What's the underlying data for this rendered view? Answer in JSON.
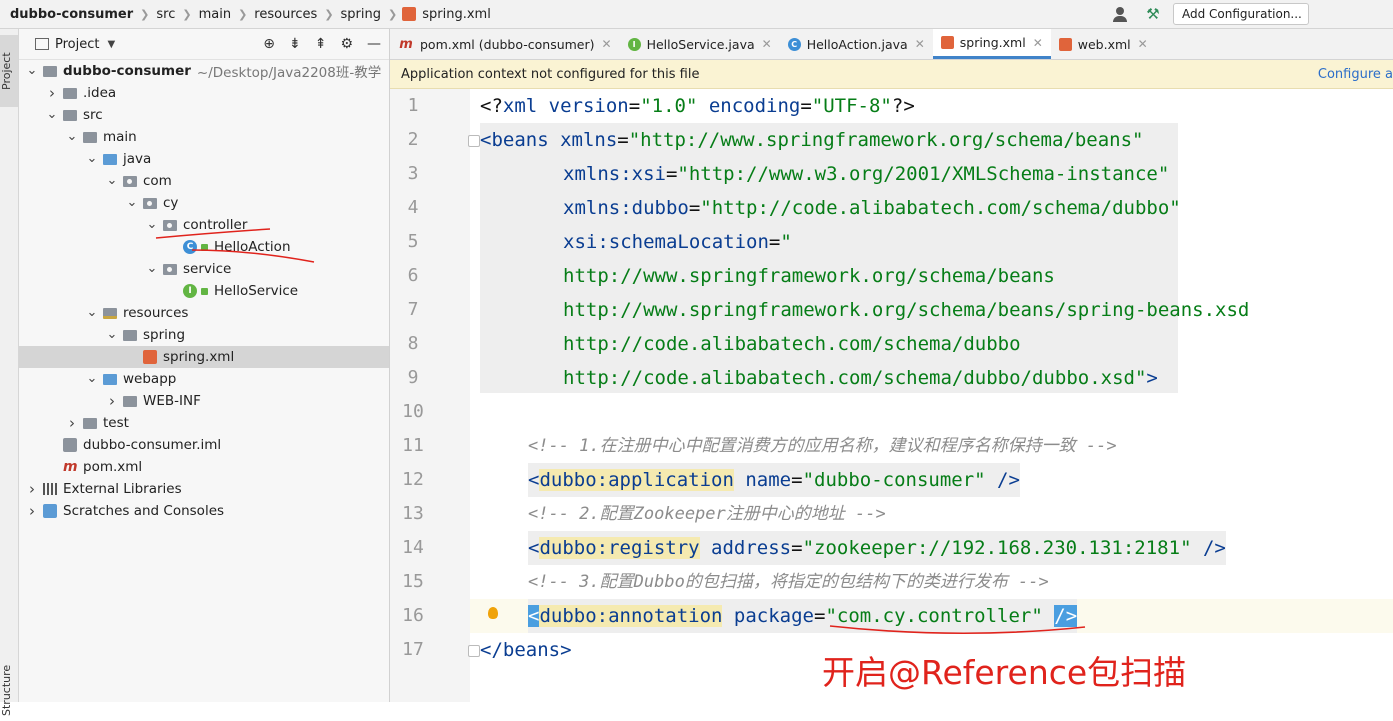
{
  "breadcrumb": {
    "segments": [
      "dubbo-consumer",
      "src",
      "main",
      "resources",
      "spring",
      "spring.xml"
    ]
  },
  "toolbar": {
    "add_configuration": "Add Configuration..."
  },
  "side_stripe": {
    "project": "Project",
    "structure": "Structure"
  },
  "project_panel": {
    "title": "Project",
    "tree": [
      {
        "label": "dubbo-consumer",
        "extra": "~/Desktop/Java2208班-教学",
        "depth": 0,
        "arrow": "down",
        "icon": "folder"
      },
      {
        "label": ".idea",
        "depth": 1,
        "arrow": "right",
        "icon": "folder"
      },
      {
        "label": "src",
        "depth": 1,
        "arrow": "down",
        "icon": "folder"
      },
      {
        "label": "main",
        "depth": 2,
        "arrow": "down",
        "icon": "folder"
      },
      {
        "label": "java",
        "depth": 3,
        "arrow": "down",
        "icon": "folder-blue"
      },
      {
        "label": "com",
        "depth": 4,
        "arrow": "down",
        "icon": "package"
      },
      {
        "label": "cy",
        "depth": 5,
        "arrow": "down",
        "icon": "package"
      },
      {
        "label": "controller",
        "depth": 6,
        "arrow": "down",
        "icon": "package"
      },
      {
        "label": "HelloAction",
        "depth": 7,
        "arrow": "",
        "icon": "class"
      },
      {
        "label": "service",
        "depth": 6,
        "arrow": "down",
        "icon": "package"
      },
      {
        "label": "HelloService",
        "depth": 7,
        "arrow": "",
        "icon": "interface"
      },
      {
        "label": "resources",
        "depth": 3,
        "arrow": "down",
        "icon": "folder-res"
      },
      {
        "label": "spring",
        "depth": 4,
        "arrow": "down",
        "icon": "folder"
      },
      {
        "label": "spring.xml",
        "depth": 5,
        "arrow": "",
        "icon": "xml",
        "selected": true
      },
      {
        "label": "webapp",
        "depth": 3,
        "arrow": "down",
        "icon": "folder-blue"
      },
      {
        "label": "WEB-INF",
        "depth": 4,
        "arrow": "right",
        "icon": "folder"
      },
      {
        "label": "test",
        "depth": 2,
        "arrow": "right",
        "icon": "folder"
      },
      {
        "label": "dubbo-consumer.iml",
        "depth": 1,
        "arrow": "",
        "icon": "iml"
      },
      {
        "label": "pom.xml",
        "depth": 1,
        "arrow": "",
        "icon": "maven"
      },
      {
        "label": "External Libraries",
        "depth": 0,
        "arrow": "right",
        "icon": "lib"
      },
      {
        "label": "Scratches and Consoles",
        "depth": 0,
        "arrow": "right",
        "icon": "scratch"
      }
    ]
  },
  "tabs": [
    {
      "label": "pom.xml (dubbo-consumer)",
      "icon": "m"
    },
    {
      "label": "HelloService.java",
      "icon": "i"
    },
    {
      "label": "HelloAction.java",
      "icon": "c"
    },
    {
      "label": "spring.xml",
      "icon": "x",
      "active": true
    },
    {
      "label": "web.xml",
      "icon": "x"
    }
  ],
  "banner": {
    "message": "Application context not configured for this file",
    "link": "Configure a"
  },
  "code": {
    "line_numbers": [
      "1",
      "2",
      "3",
      "4",
      "5",
      "6",
      "7",
      "8",
      "9",
      "10",
      "11",
      "12",
      "13",
      "14",
      "15",
      "16",
      "17"
    ],
    "l1a": "<?",
    "l1b": "xml version",
    "l1c": "=",
    "l1d": "\"1.0\"",
    "l1e": " encoding",
    "l1f": "=",
    "l1g": "\"UTF-8\"",
    "l1h": "?>",
    "l2a": "<beans ",
    "l2b": "xmlns",
    "l2c": "=",
    "l2d": "\"http://www.springframework.org/schema/beans\"",
    "l3a": "xmlns:xsi",
    "l3b": "=",
    "l3c": "\"http://www.w3.org/2001/XMLSchema-instance\"",
    "l4a": "xmlns:dubbo",
    "l4b": "=",
    "l4c": "\"http://code.alibabatech.com/schema/dubbo\"",
    "l5a": "xsi:schemaLocation",
    "l5b": "=",
    "l5c": "\"",
    "l6": "http://www.springframework.org/schema/beans",
    "l7": "http://www.springframework.org/schema/beans/spring-beans.xsd",
    "l8": "http://code.alibabatech.com/schema/dubbo",
    "l9a": "http://code.alibabatech.com/schema/dubbo/dubbo.xsd\"",
    "l9b": ">",
    "l11": "<!-- 1.在注册中心中配置消费方的应用名称，建议和程序名称保持一致 -->",
    "l12a": "<",
    "l12b": "dubbo:application",
    "l12c": " name",
    "l12d": "=",
    "l12e": "\"dubbo-consumer\"",
    "l12f": " />",
    "l13": "<!-- 2.配置Zookeeper注册中心的地址 -->",
    "l14a": "<",
    "l14b": "dubbo:registry",
    "l14c": " address",
    "l14d": "=",
    "l14e": "\"zookeeper://192.168.230.131:2181\"",
    "l14f": " />",
    "l15": "<!-- 3.配置Dubbo的包扫描，将指定的包结构下的类进行发布 -->",
    "l16a": "<",
    "l16b": "dubbo:annotation",
    "l16c": " package",
    "l16d": "=",
    "l16e": "\"com.cy.controller\"",
    "l16f": " ",
    "l16g": "/>",
    "l17": "</beans>"
  },
  "annotation": "开启@Reference包扫描",
  "colors": {
    "tag": "#0a3d91",
    "string": "#067d17",
    "comment": "#8c8c8c",
    "annotation_red": "#e0231c",
    "banner_bg": "#faf3d3"
  }
}
